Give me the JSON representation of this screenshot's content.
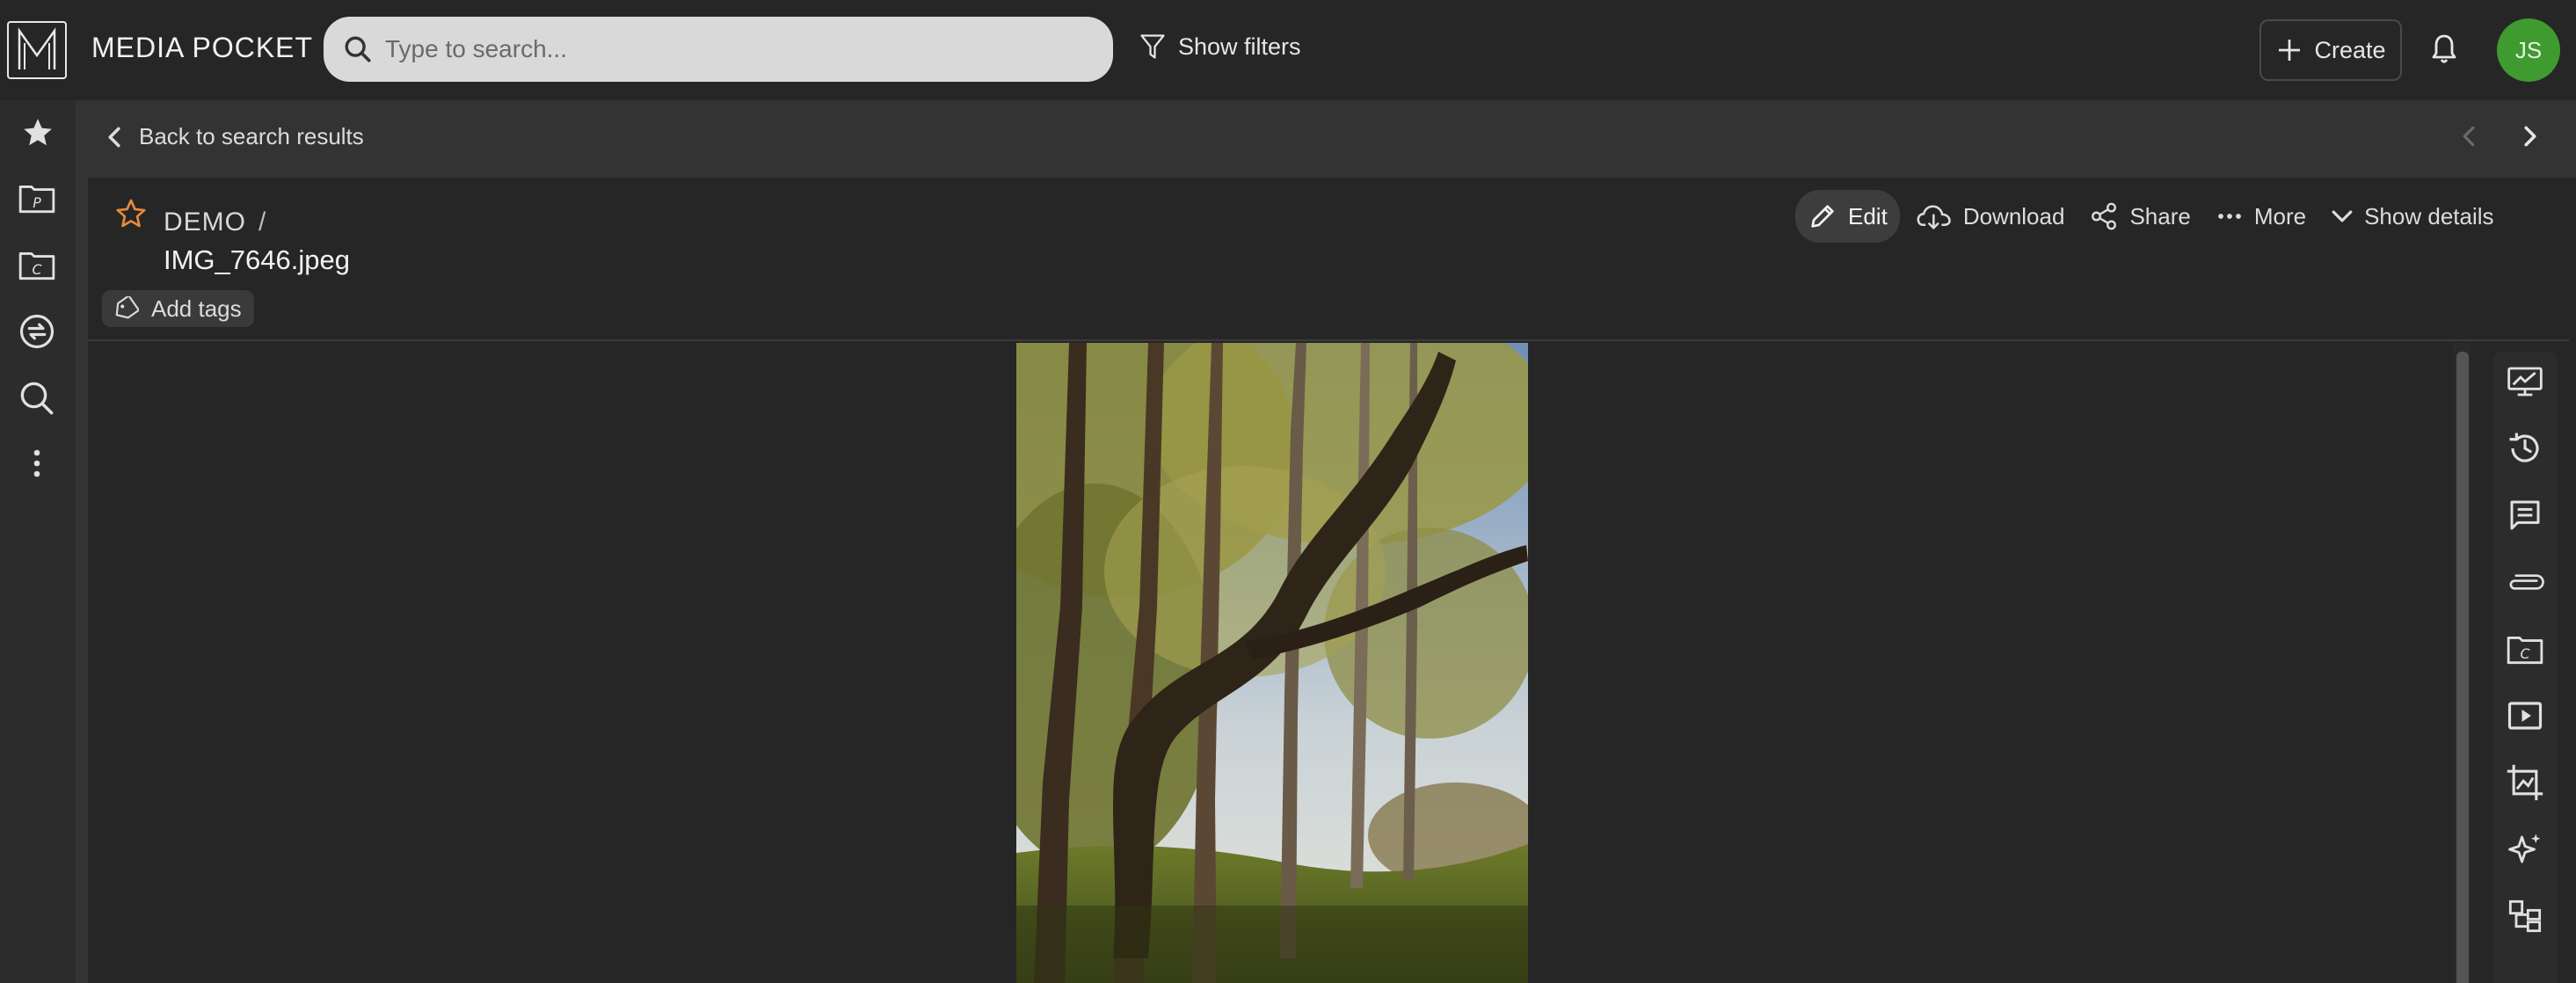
{
  "app": {
    "brand": "MEDIA POCKET",
    "logo_letter": "M"
  },
  "search": {
    "placeholder": "Type to search..."
  },
  "toolbar": {
    "filters_label": "Show filters",
    "create_label": "Create",
    "avatar_initials": "JS",
    "avatar_color": "#3f9a2f"
  },
  "left_nav": {
    "items": [
      {
        "icon": "star-icon"
      },
      {
        "icon": "folder-p-icon"
      },
      {
        "icon": "folder-c-icon"
      },
      {
        "icon": "sync-icon"
      },
      {
        "icon": "search-icon"
      },
      {
        "icon": "more-vertical-icon"
      }
    ]
  },
  "navbar": {
    "back_label": "Back to search results"
  },
  "asset": {
    "collection": "DEMO",
    "separator": "/",
    "filename": "IMG_7646.jpeg",
    "add_tags_label": "Add tags",
    "favorite_color": "#e8893a"
  },
  "actions": {
    "edit": "Edit",
    "download": "Download",
    "share": "Share",
    "more": "More",
    "details": "Show details"
  },
  "right_panel": {
    "items": [
      {
        "icon": "presentation-chart-icon"
      },
      {
        "icon": "history-icon"
      },
      {
        "icon": "comments-icon"
      },
      {
        "icon": "attachment-icon"
      },
      {
        "icon": "folder-c-icon"
      },
      {
        "icon": "play-icon"
      },
      {
        "icon": "crop-image-icon"
      },
      {
        "icon": "ai-sparkle-icon"
      },
      {
        "icon": "hierarchy-icon"
      }
    ]
  }
}
